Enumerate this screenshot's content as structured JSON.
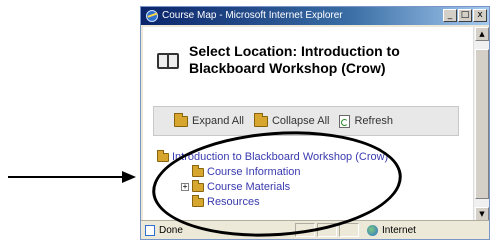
{
  "window": {
    "title": "Course Map - Microsoft Internet Explorer",
    "buttons": [
      "_",
      "□",
      "x"
    ]
  },
  "heading": {
    "title": "Select Location: Introduction to Blackboard Workshop (Crow)"
  },
  "toolbar": {
    "expand_all": "Expand All",
    "collapse_all": "Collapse All",
    "refresh": "Refresh"
  },
  "tree": {
    "root": "Introduction to Blackboard Workshop (Crow)",
    "items": [
      {
        "label": "Course Information",
        "expandable": false
      },
      {
        "label": "Course Materials",
        "expandable": true,
        "expander": "+"
      },
      {
        "label": "Resources",
        "expandable": false
      }
    ]
  },
  "status": {
    "left": "Done",
    "zone": "Internet"
  },
  "scroll": {
    "up": "▲",
    "down": "▼"
  }
}
